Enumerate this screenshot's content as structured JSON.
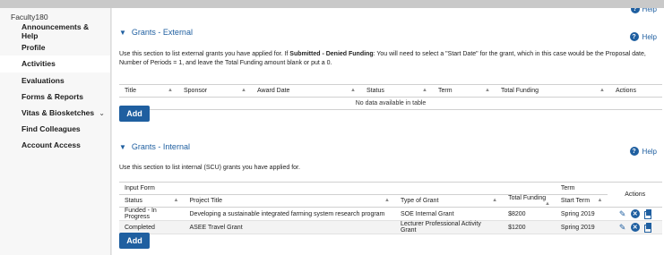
{
  "sidebar": {
    "brand": "Faculty180",
    "items": [
      {
        "label": "Announcements & Help"
      },
      {
        "label": "Profile"
      },
      {
        "label": "Activities"
      },
      {
        "label": "Evaluations"
      },
      {
        "label": "Forms & Reports"
      },
      {
        "label": "Vitas & Biosketches"
      },
      {
        "label": "Find Colleagues"
      },
      {
        "label": "Account Access"
      }
    ],
    "active": "Activities"
  },
  "help_label": "Help",
  "external": {
    "title": "Grants - External",
    "description_before": "Use this section to list external grants you have applied for. If ",
    "description_bold": "Submitted - Denied Funding",
    "description_after": ": You will need to select a \"Start Date\" for the grant, which in this case would be the Proposal date, Number of Periods = 1, and leave the Total Funding amount blank or put a 0.",
    "columns": [
      "Title",
      "Sponsor",
      "Award Date",
      "Status",
      "Term",
      "Total Funding",
      "Actions"
    ],
    "empty_text": "No data available in table",
    "add_label": "Add"
  },
  "internal": {
    "title": "Grants - Internal",
    "description": "Use this section to list internal (SCU) grants you have applied for.",
    "group_headers": {
      "input_form": "Input Form",
      "term": "Term",
      "actions": "Actions"
    },
    "columns": [
      "Status",
      "Project Title",
      "Type of Grant",
      "Total Funding",
      "Start Term"
    ],
    "rows": [
      {
        "status": "Funded - In Progress",
        "project_title": "Developing a sustainable integrated farming system research program",
        "type_of_grant": "SOE Internal Grant",
        "total_funding": "$8200",
        "start_term": "Spring 2019"
      },
      {
        "status": "Completed",
        "project_title": "ASEE Travel Grant",
        "type_of_grant": "Lecturer Professional Activity Grant",
        "total_funding": "$1200",
        "start_term": "Spring 2019"
      }
    ],
    "add_label": "Add"
  },
  "icons": {
    "help": "question-circle-icon",
    "edit": "pencil-icon",
    "delete": "x-circle-icon",
    "copy": "copy-icon"
  },
  "colors": {
    "accent": "#1f5fa0"
  }
}
